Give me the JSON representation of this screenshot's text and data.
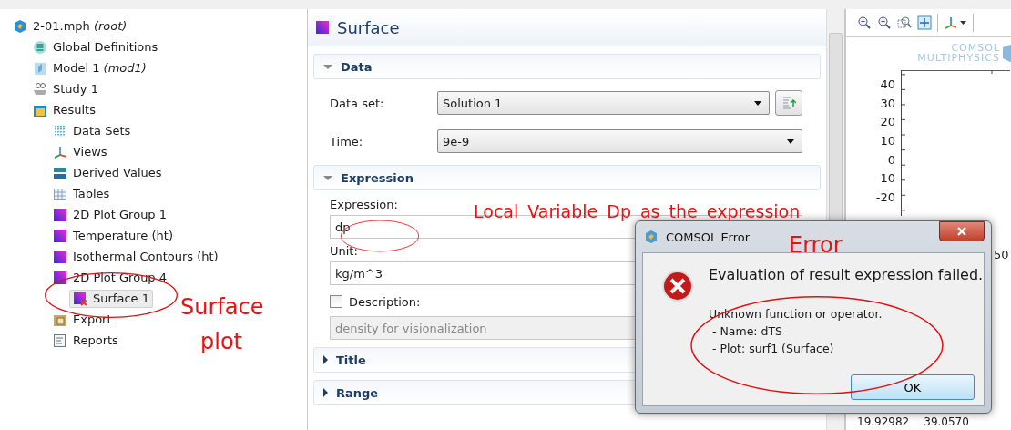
{
  "model_tree": {
    "items": [
      {
        "label": "2-01.mph *(root)*",
        "kind": "root",
        "selected": false,
        "children": [
          {
            "label": "Global Definitions",
            "kind": "definitions",
            "selected": false
          },
          {
            "label": "Model 1 *(mod1)*",
            "kind": "model",
            "selected": false
          },
          {
            "label": "Study 1",
            "kind": "study",
            "selected": false
          },
          {
            "label": "Results",
            "kind": "results",
            "selected": false,
            "children": [
              {
                "label": "Data Sets",
                "kind": "datasets",
                "selected": false
              },
              {
                "label": "Views",
                "kind": "views",
                "selected": false
              },
              {
                "label": "Derived Values",
                "kind": "derived",
                "selected": false
              },
              {
                "label": "Tables",
                "kind": "tables",
                "selected": false
              },
              {
                "label": "2D Plot Group 1",
                "kind": "plotgroup",
                "selected": false
              },
              {
                "label": "Temperature (ht)",
                "kind": "plotgroup",
                "selected": false
              },
              {
                "label": "Isothermal Contours (ht)",
                "kind": "plotgroup",
                "selected": false
              },
              {
                "label": "2D Plot Group 4",
                "kind": "plotgroup",
                "selected": false,
                "children": [
                  {
                    "label": "Surface 1",
                    "kind": "surface",
                    "selected": true
                  }
                ]
              },
              {
                "label": "Export",
                "kind": "export",
                "selected": false
              },
              {
                "label": "Reports",
                "kind": "reports",
                "selected": false
              }
            ]
          }
        ]
      }
    ]
  },
  "settings": {
    "title": "Surface",
    "sections": [
      {
        "title": "Data",
        "expanded": true,
        "fields": [
          {
            "kind": "select",
            "label": "Data set:",
            "value": "Solution 1",
            "button": true
          },
          {
            "kind": "select",
            "label": "Time:",
            "value": "9e-9",
            "button": false
          }
        ]
      },
      {
        "title": "Expression",
        "expanded": true,
        "fields": [
          {
            "kind": "text",
            "label": "Expression:",
            "value": "dp"
          },
          {
            "kind": "text",
            "label": "Unit:",
            "value": "kg/m^3"
          },
          {
            "kind": "check-text",
            "label": "Description:",
            "checked": false,
            "value": "density for visionalization",
            "disabled": true
          }
        ]
      },
      {
        "title": "Title",
        "expanded": false
      },
      {
        "title": "Range",
        "expanded": false
      }
    ]
  },
  "graphics": {
    "logo_lines": [
      "COMSOL",
      "MULTIPHYSICS"
    ],
    "y_ticks": [
      "40",
      "30",
      "20",
      "10",
      "0",
      "-10",
      "-20"
    ],
    "x_tick": "50",
    "table_row": [
      "19.92982",
      "39.0570"
    ]
  },
  "dialog": {
    "title": "COMSOL Error",
    "message": "Evaluation of result expression failed.",
    "details": [
      "Unknown function or operator.",
      " - Name: dTS",
      " - Plot: surf1 (Surface)"
    ],
    "button": "OK"
  },
  "annotations": [
    {
      "text": "Local Variable Dp as the expression"
    },
    {
      "text": "Error"
    },
    {
      "text": "Surface plot"
    }
  ]
}
